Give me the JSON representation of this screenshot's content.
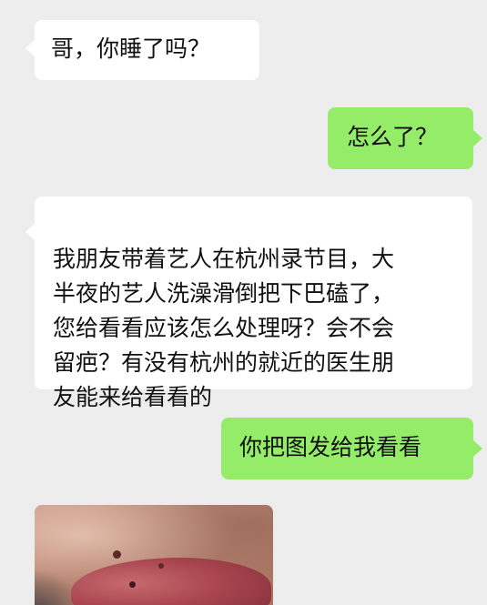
{
  "chat": {
    "messages": [
      {
        "side": "in",
        "text": "哥，你睡了吗？"
      },
      {
        "side": "out",
        "text": "怎么了？"
      },
      {
        "side": "in",
        "text": "我朋友带着艺人在杭州录节目，大\n半夜的艺人洗澡滑倒把下巴磕了，\n您给看看应该怎么处理呀？会不会\n留疤？有没有杭州的就近的医生朋\n友能来给看看的"
      },
      {
        "side": "out",
        "text": "你把图发给我看看"
      }
    ]
  },
  "colors": {
    "background": "#ededed",
    "incoming_bubble": "#ffffff",
    "outgoing_bubble": "#95ec69"
  }
}
